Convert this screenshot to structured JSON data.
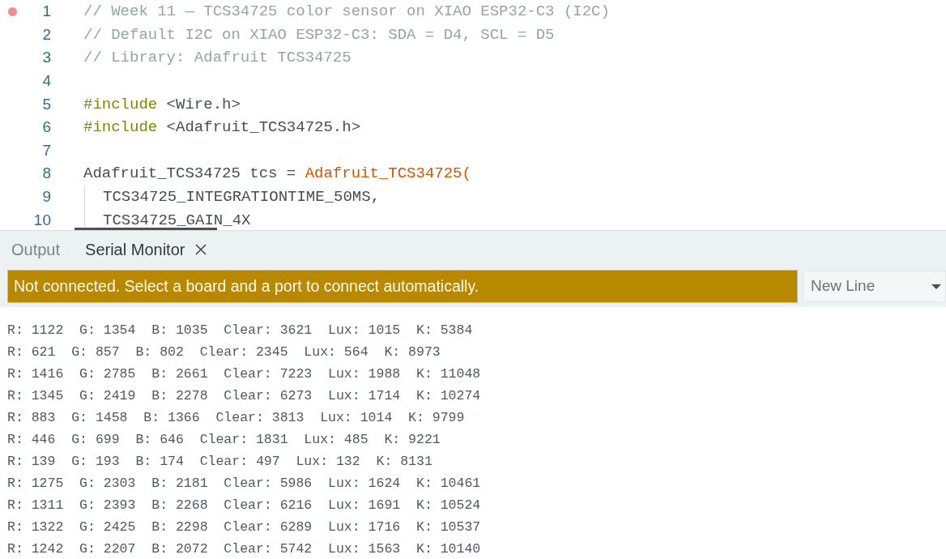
{
  "editor": {
    "lines": [
      {
        "number": "1",
        "breakpoint": true,
        "tokens": [
          {
            "kind": "comment",
            "text": "// Week 11 — TCS34725 color sensor on XIAO ESP32-C3 (I2C)"
          }
        ]
      },
      {
        "number": "2",
        "breakpoint": false,
        "tokens": [
          {
            "kind": "comment",
            "text": "// Default I2C on XIAO ESP32-C3: SDA = D4, SCL = D5"
          }
        ]
      },
      {
        "number": "3",
        "breakpoint": false,
        "tokens": [
          {
            "kind": "comment",
            "text": "// Library: Adafruit TCS34725"
          }
        ]
      },
      {
        "number": "4",
        "breakpoint": false
      },
      {
        "number": "5",
        "breakpoint": false,
        "tokens": [
          {
            "kind": "directive",
            "text": "#include"
          },
          {
            "kind": "plain",
            "text": " <Wire.h>"
          }
        ]
      },
      {
        "number": "6",
        "breakpoint": false,
        "tokens": [
          {
            "kind": "directive",
            "text": "#include"
          },
          {
            "kind": "plain",
            "text": " <Adafruit_TCS34725.h>"
          }
        ]
      },
      {
        "number": "7",
        "breakpoint": false
      },
      {
        "number": "8",
        "breakpoint": false,
        "tokens": [
          {
            "kind": "plain",
            "text": "Adafruit_TCS34725 tcs = "
          },
          {
            "kind": "function",
            "text": "Adafruit_TCS34725("
          }
        ],
        "children": [
          {
            "number": "9",
            "breakpoint": false,
            "tokens": [
              {
                "kind": "plain",
                "text": "TCS34725_INTEGRATIONTIME_50MS,"
              }
            ]
          },
          {
            "number": "10",
            "breakpoint": false,
            "tokens": [
              {
                "kind": "plain",
                "text": "TCS34725_GAIN_4X"
              }
            ]
          }
        ]
      }
    ]
  },
  "panel": {
    "tabs": [
      {
        "label": "Output",
        "selected": false
      },
      {
        "label": "Serial Monitor",
        "selected": true
      }
    ],
    "connection_banner": {
      "text": "Not connected. Select a board and a port to connect automatically."
    },
    "line_ending": {
      "value": "New Line"
    },
    "serial_output": [
      "R: 1122  G: 1354  B: 1035  Clear: 3621  Lux: 1015  K: 5384",
      "R: 621  G: 857  B: 802  Clear: 2345  Lux: 564  K: 8973",
      "R: 1416  G: 2785  B: 2661  Clear: 7223  Lux: 1988  K: 11048",
      "R: 1345  G: 2419  B: 2278  Clear: 6273  Lux: 1714  K: 10274",
      "R: 883  G: 1458  B: 1366  Clear: 3813  Lux: 1014  K: 9799",
      "R: 446  G: 699  B: 646  Clear: 1831  Lux: 485  K: 9221",
      "R: 139  G: 193  B: 174  Clear: 497  Lux: 132  K: 8131",
      "R: 1275  G: 2303  B: 2181  Clear: 5986  Lux: 1624  K: 10461",
      "R: 1311  G: 2393  B: 2268  Clear: 6216  Lux: 1691  K: 10524",
      "R: 1322  G: 2425  B: 2298  Clear: 6289  Lux: 1716  K: 10537",
      "R: 1242  G: 2207  B: 2072  Clear: 5742  Lux: 1563  K: 10140"
    ]
  }
}
